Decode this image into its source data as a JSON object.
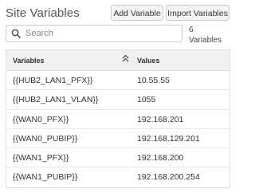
{
  "header": {
    "title": "Site Variables",
    "add_label": "Add Variable",
    "import_label": "Import Variables"
  },
  "search": {
    "placeholder": "Search",
    "value": "",
    "count_number": "6",
    "count_label": "Variables"
  },
  "table": {
    "columns": [
      "Variables",
      "Values"
    ],
    "sort_icon": "chevron-double-up",
    "rows": [
      {
        "variable": "{{HUB2_LAN1_PFX}}",
        "value": "10.55.55"
      },
      {
        "variable": "{{HUB2_LAN1_VLAN}}",
        "value": "1055"
      },
      {
        "variable": "{{WAN0_PFX}}",
        "value": "192.168.201"
      },
      {
        "variable": "{{WAN0_PUBIP}}",
        "value": "192.168.129.201"
      },
      {
        "variable": "{{WAN1_PFX}}",
        "value": "192.168.200"
      },
      {
        "variable": "{{WAN1_PUBIP}}",
        "value": "192.168.200.254"
      }
    ]
  }
}
